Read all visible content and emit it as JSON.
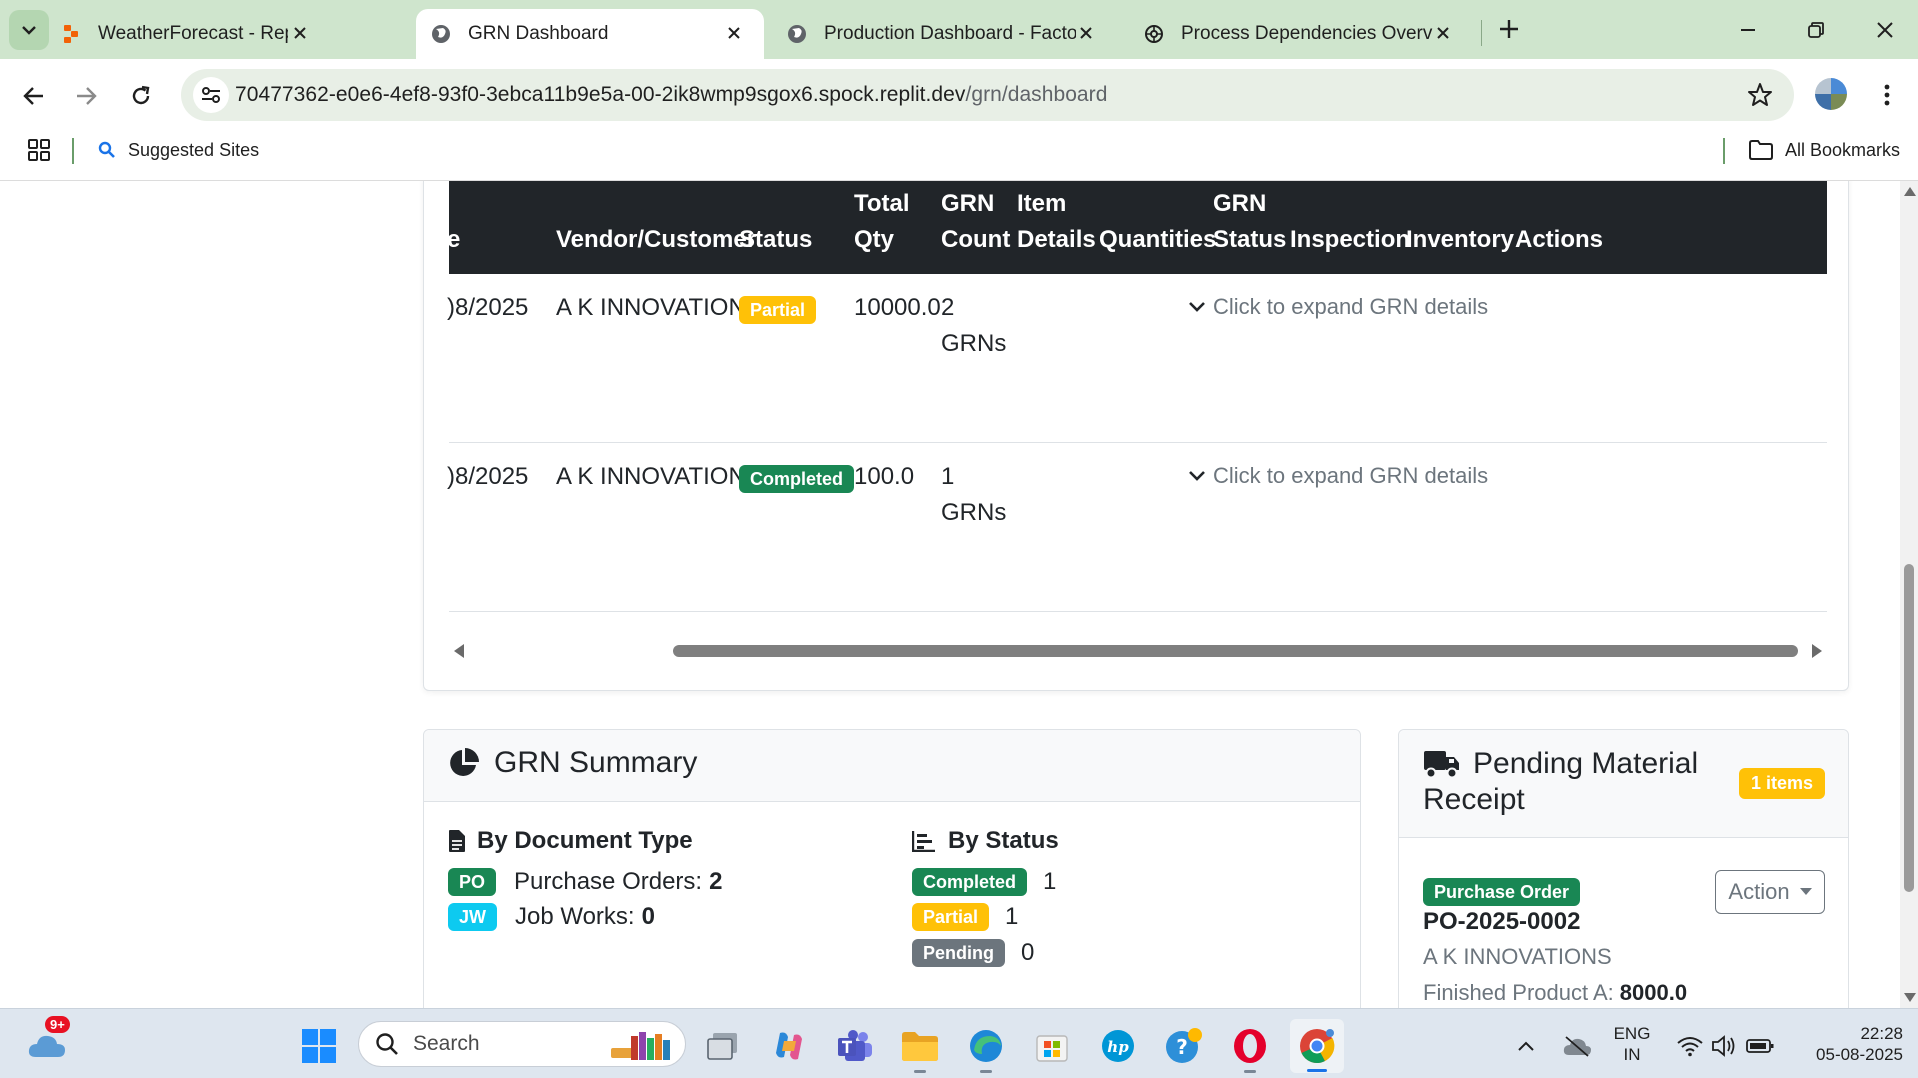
{
  "browser": {
    "tabs": [
      {
        "title": "WeatherForecast - Replit",
        "icon": "replit-icon",
        "active": false
      },
      {
        "title": "GRN Dashboard",
        "icon": "globe-icon",
        "active": true
      },
      {
        "title": "Production Dashboard - Factory",
        "icon": "globe-icon",
        "active": false
      },
      {
        "title": "Process Dependencies Overview",
        "icon": "openai-icon",
        "active": false
      }
    ],
    "url_host": "70477362-e0e6-4ef8-93f0-3ebca11b9e5a-00-2ik8wmp9sgox6.spock.replit.dev",
    "url_path": "/grn/dashboard",
    "bookmarks": {
      "suggested": "Suggested Sites",
      "all": "All Bookmarks"
    }
  },
  "grn_table": {
    "headers": {
      "date": "e",
      "vendor": "Vendor/Customer",
      "status": "Status",
      "total_qty": [
        "Total",
        "Qty"
      ],
      "grn_count": [
        "GRN",
        "Count"
      ],
      "item_details": [
        "Item",
        "Details"
      ],
      "quantities": "Quantities",
      "grn_status": [
        "GRN",
        "Status"
      ],
      "inspection": "Inspection",
      "inventory": "Inventory",
      "actions": "Actions"
    },
    "rows": [
      {
        "date": ")8/2025",
        "vendor": "A K INNOVATIONS",
        "status": "Partial",
        "total_qty": "10000.0",
        "grn_count": "2",
        "grn_label": "GRNs",
        "expand": "Click to expand GRN details"
      },
      {
        "date": ")8/2025",
        "vendor": "A K INNOVATIONS",
        "status": "Completed",
        "total_qty": "100.0",
        "grn_count": "1",
        "grn_label": "GRNs",
        "expand": "Click to expand GRN details"
      }
    ]
  },
  "grn_summary": {
    "title": "GRN Summary",
    "by_doc_type": {
      "title": "By Document Type",
      "items": [
        {
          "badge": "PO",
          "label": "Purchase Orders:",
          "count": "2"
        },
        {
          "badge": "JW",
          "label": "Job Works:",
          "count": "0"
        }
      ]
    },
    "by_status": {
      "title": "By Status",
      "items": [
        {
          "badge": "Completed",
          "count": "1"
        },
        {
          "badge": "Partial",
          "count": "1"
        },
        {
          "badge": "Pending",
          "count": "0"
        }
      ]
    }
  },
  "pending": {
    "title_line1": "Pending Material",
    "title_line2": "Receipt",
    "count_badge": "1 items",
    "item": {
      "type_badge": "Purchase Order",
      "number": "PO-2025-0002",
      "vendor": "A K INNOVATIONS",
      "product_label": "Finished Product A:",
      "product_qty": "8000.0",
      "action_label": "Action"
    }
  },
  "taskbar": {
    "search_placeholder": "Search",
    "weather_badge": "9+",
    "lang_line1": "ENG",
    "lang_line2": "IN",
    "time": "22:28",
    "date": "05-08-2025"
  },
  "colors": {
    "partial": "#ffc107",
    "completed": "#198754",
    "pending": "#6c757d",
    "info": "#0dcaf0",
    "table_header": "#212529",
    "chrome_tabstrip": "#cfe5cd"
  }
}
